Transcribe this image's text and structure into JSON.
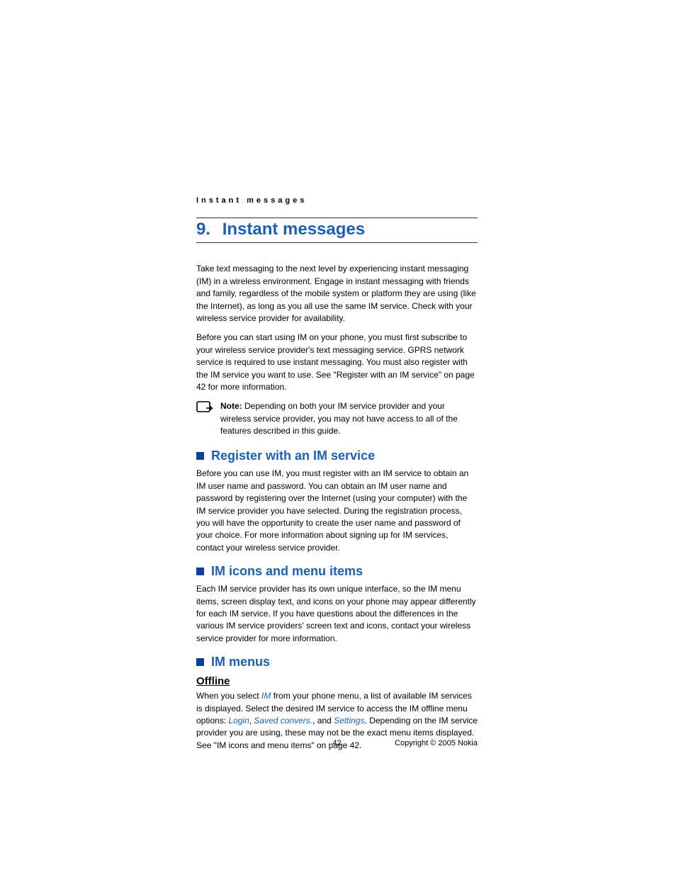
{
  "header": {
    "running": "Instant messages"
  },
  "chapter": {
    "number": "9.",
    "title": "Instant messages"
  },
  "intro": {
    "p1": "Take text messaging to the next level by experiencing instant messaging (IM) in a wireless environment. Engage in instant messaging with friends and family, regardless of the mobile system or platform they are using (like the Internet), as long as you all use the same IM service. Check with your wireless service provider for availability.",
    "p2": "Before you can start using IM on your phone, you must first subscribe to your wireless service provider's text messaging service. GPRS network service is required to use instant messaging. You must also register with the IM service you want to use. See \"Register with an IM service\" on page 42 for more information."
  },
  "note": {
    "label": "Note:",
    "text": " Depending on both your IM service provider and your wireless service provider, you may not have access to all of the features described in this guide."
  },
  "sections": {
    "register": {
      "title": "Register with an IM service",
      "body": "Before you can use IM, you must register with an IM service to obtain an IM user name and password. You can obtain an IM user name and password by registering over the Internet (using your computer) with the IM service provider you have selected. During the registration process, you will have the opportunity to create the user name and password of your choice. For more information about signing up for IM services, contact your wireless service provider."
    },
    "iconsMenus": {
      "title": "IM icons and menu items",
      "body": "Each IM service provider has its own unique interface, so the IM menu items, screen display text, and icons on your phone may appear differently for each IM service. If you have questions about the differences in the various IM service providers' screen text and icons, contact your wireless service provider for more information."
    },
    "imMenus": {
      "title": "IM menus",
      "offline": {
        "heading": "Offline",
        "pre": "When you select ",
        "imLink": "IM",
        "mid1": " from your phone menu, a list of available IM services is displayed. Select the desired IM service to access the IM offline menu options: ",
        "login": "Login",
        "comma1": ", ",
        "saved": "Saved convers.",
        "comma2": ", and ",
        "settings": "Settings",
        "post": ". Depending on the IM service provider you are using, these may not be the exact menu items displayed. See \"IM icons and menu items\" on page 42."
      }
    }
  },
  "footer": {
    "page": "42",
    "copyright": "Copyright © 2005 Nokia"
  }
}
